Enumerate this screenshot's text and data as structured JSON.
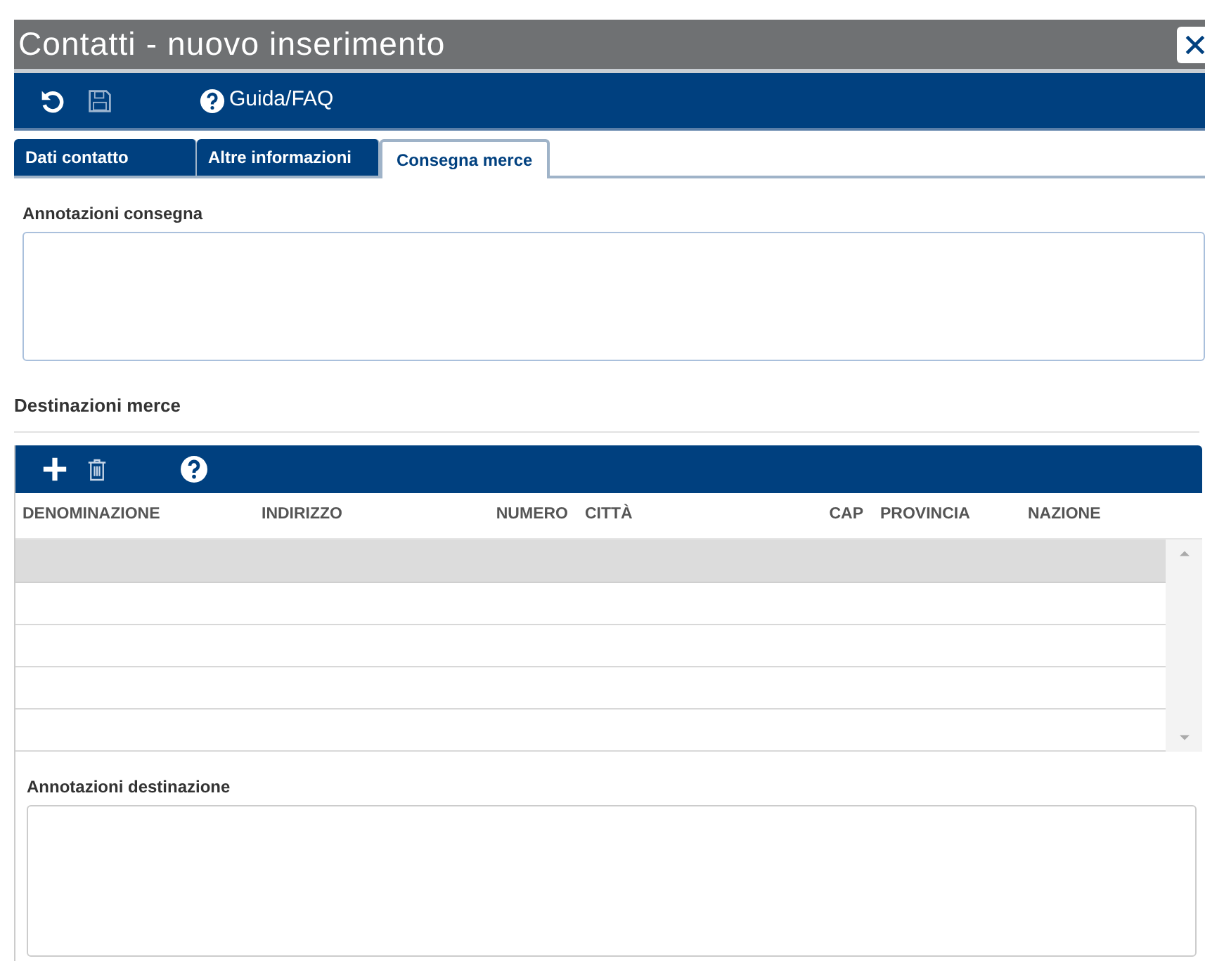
{
  "window": {
    "title": "Contatti - nuovo inserimento"
  },
  "toolbar": {
    "help_label": "Guida/FAQ"
  },
  "tabs": [
    {
      "label": "Dati contatto",
      "selected": false
    },
    {
      "label": "Altre informazioni",
      "selected": false
    },
    {
      "label": "Consegna merce",
      "selected": true
    }
  ],
  "delivery_notes": {
    "label": "Annotazioni consegna"
  },
  "destinations": {
    "title": "Destinazioni merce",
    "columns": [
      "DENOMINAZIONE",
      "INDIRIZZO",
      "NUMERO",
      "CITTÀ",
      "CAP",
      "PROVINCIA",
      "NAZIONE"
    ],
    "rows": [
      {
        "selected": true
      },
      {
        "selected": false
      },
      {
        "selected": false
      },
      {
        "selected": false
      },
      {
        "selected": false
      }
    ]
  },
  "destination_notes": {
    "label": "Annotazioni destinazione"
  }
}
